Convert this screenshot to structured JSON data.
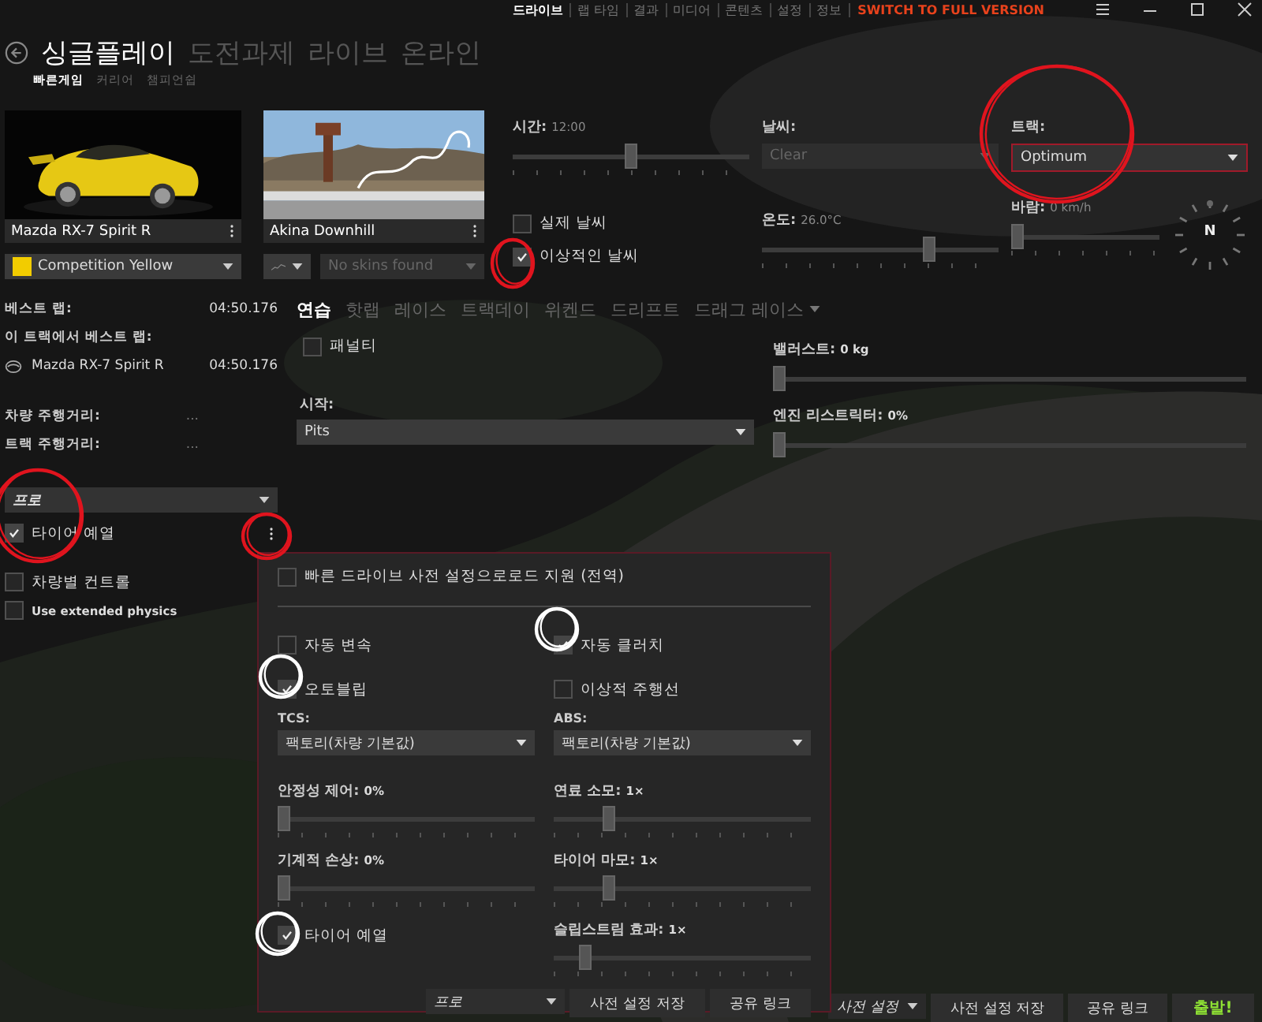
{
  "title_bar": {
    "menu": [
      {
        "label": "드라이브",
        "selected": true
      },
      {
        "label": "랩 타임",
        "selected": false
      },
      {
        "label": "결과",
        "selected": false
      },
      {
        "label": "미디어",
        "selected": false
      },
      {
        "label": "콘텐츠",
        "selected": false
      },
      {
        "label": "설정",
        "selected": false
      },
      {
        "label": "정보",
        "selected": false
      }
    ],
    "upgrade_link": "SWITCH TO FULL VERSION"
  },
  "main_tabs": [
    {
      "label": "싱글플레이",
      "selected": true
    },
    {
      "label": "도전과제",
      "selected": false
    },
    {
      "label": "라이브",
      "selected": false
    },
    {
      "label": "온라인",
      "selected": false
    }
  ],
  "sub_tabs": [
    {
      "label": "빠른게임",
      "selected": true
    },
    {
      "label": "커리어",
      "selected": false
    },
    {
      "label": "챔피언쉽",
      "selected": false
    }
  ],
  "car": {
    "name": "Mazda RX-7 Spirit R",
    "skin": "Competition Yellow"
  },
  "track": {
    "name": "Akina Downhill",
    "skin": "No skins found"
  },
  "conditions": {
    "time": {
      "label": "시간:",
      "value": "12:00",
      "level": 0.5
    },
    "weather": {
      "label": "날씨:",
      "value": "Clear",
      "disabled": true
    },
    "track_state": {
      "label": "트랙:",
      "value": "Optimum"
    },
    "real_weather": {
      "label": "실제 날씨",
      "checked": false
    },
    "ideal_weather": {
      "label": "이상적인 날씨",
      "checked": true
    },
    "temperature": {
      "label": "온도:",
      "value": "26.0°C",
      "level": 0.72
    },
    "wind": {
      "label": "바람:",
      "value": "0 km/h",
      "level": 0
    },
    "compass": "N"
  },
  "records": {
    "best_lap": {
      "label": "베스트 랩:",
      "value": "04:50.176"
    },
    "track_best_label": "이 트랙에서 베스트 랩:",
    "track_best": {
      "car": "Mazda RX-7 Spirit R",
      "value": "04:50.176"
    },
    "car_distance": {
      "label": "차량 주행거리:",
      "value": "..."
    },
    "track_distance": {
      "label": "트랙 주행거리:",
      "value": "..."
    }
  },
  "assist_preset": "프로",
  "left_options": [
    {
      "label": "타이어 예열",
      "checked": true
    },
    {
      "label": "차량별 컨트롤",
      "checked": false
    },
    {
      "label": "Use extended physics",
      "checked": false
    }
  ],
  "modes": [
    {
      "label": "연습",
      "selected": true,
      "menu": false
    },
    {
      "label": "핫랩",
      "selected": false,
      "menu": false
    },
    {
      "label": "레이스",
      "selected": false,
      "menu": false
    },
    {
      "label": "트랙데이",
      "selected": false,
      "menu": false
    },
    {
      "label": "위켄드",
      "selected": false,
      "menu": false
    },
    {
      "label": "드리프트",
      "selected": false,
      "menu": false
    },
    {
      "label": "드래그 레이스",
      "selected": false,
      "menu": true
    }
  ],
  "session": {
    "penalty": {
      "label": "패널티",
      "checked": false
    },
    "start": {
      "label": "시작:",
      "value": "Pits"
    },
    "ballast": {
      "label": "밸러스트:",
      "value": "0 kg",
      "level": 0
    },
    "restrictor": {
      "label": "엔진 리스트릭터:",
      "value": "0%",
      "level": 0
    }
  },
  "assists": {
    "quick_preset": {
      "label": "빠른 드라이브 사전 설정으로로드 지원 (전역)",
      "checked": false
    },
    "items": [
      {
        "kind": "checkbox",
        "label": "자동 변속",
        "checked": false
      },
      {
        "kind": "checkbox",
        "label": "자동 클러치",
        "checked": true
      },
      {
        "kind": "checkbox",
        "label": "오토블립",
        "checked": true
      },
      {
        "kind": "checkbox",
        "label": "이상적 주행선",
        "checked": false
      },
      {
        "kind": "dropdown",
        "label": "TCS:",
        "value": "팩토리(차량 기본값)"
      },
      {
        "kind": "dropdown",
        "label": "ABS:",
        "value": "팩토리(차량 기본값)"
      },
      {
        "kind": "slider",
        "label": "안정성 제어:",
        "value": "0%",
        "level": 0
      },
      {
        "kind": "slider",
        "label": "연료 소모:",
        "value": "1×",
        "level": 0.2
      },
      {
        "kind": "slider",
        "label": "기계적 손상:",
        "value": "0%",
        "level": 0
      },
      {
        "kind": "slider",
        "label": "타이어 마모:",
        "value": "1×",
        "level": 0.2
      },
      {
        "kind": "checkbox",
        "label": "타이어 예열",
        "checked": true
      },
      {
        "kind": "slider",
        "label": "슬립스트림 효과:",
        "value": "1×",
        "level": 0.1
      }
    ],
    "preset": "프로",
    "buttons": [
      "사전 설정 저장",
      "공유 링크"
    ]
  },
  "bottom_bar": {
    "preset": "사전 설정",
    "buttons": [
      "사전 설정 저장",
      "공유 링크"
    ],
    "start": "출발!"
  }
}
